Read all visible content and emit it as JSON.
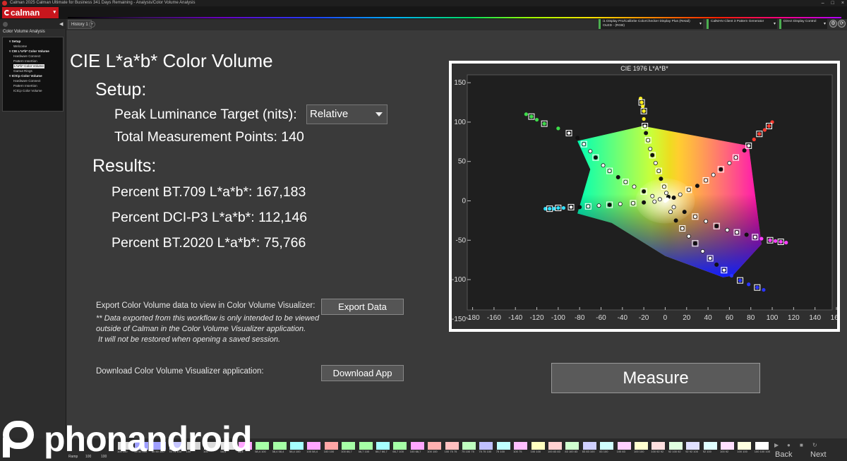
{
  "window": {
    "title": "Calman 2025 Calman Ultimate for Business 341 Days Remaining - Analysis/Color Volume Analysis",
    "controls": [
      "–",
      "□",
      "×"
    ]
  },
  "logo": {
    "text": "calman"
  },
  "sidebar": {
    "title": "Color Volume Analysis",
    "tree": [
      {
        "label": "Setup",
        "level": 1
      },
      {
        "label": "Welcome",
        "level": 2
      },
      {
        "label": "CIE L*a*b* Color Volume",
        "level": 1
      },
      {
        "label": "Hardware Connect",
        "level": 2
      },
      {
        "label": "Pattern Insertion",
        "level": 2
      },
      {
        "label": "L*a*b* Color Volume",
        "level": 2,
        "selected": true
      },
      {
        "label": "Gamut Rings",
        "level": 2
      },
      {
        "label": "ICtCp Color Volume",
        "level": 1
      },
      {
        "label": "Hardware Connect",
        "level": 2
      },
      {
        "label": "Pattern Insertion",
        "level": 2
      },
      {
        "label": "ICtCp Color Volume",
        "level": 2
      }
    ]
  },
  "tabs": {
    "history": "History 1",
    "add": "+"
  },
  "devices": [
    {
      "line1": "i1 Display Pro/Calibrite ColorChecker Display Plus (Retail)",
      "line2": "OLED - (RGB)"
    },
    {
      "line1": "CalMAN Client 3 Pattern Generator",
      "line2": ""
    },
    {
      "line1": "Direct Display Control",
      "line2": ""
    }
  ],
  "main": {
    "title": "CIE L*a*b* Color Volume",
    "setup_heading": "Setup:",
    "peak_label": "Peak Luminance Target (nits):",
    "peak_value": "Relative",
    "total_points": "Total Measurement Points: 140",
    "results_heading": "Results:",
    "result_709": "Percent BT.709 L*a*b*: 167,183",
    "result_p3": "Percent DCI-P3 L*a*b*: 112,146",
    "result_2020": "Percent BT.2020 L*a*b*: 75,766",
    "export_text": "Export Color Volume data to view in Color Volume Visualizer:",
    "export_button": "Export Data",
    "export_note": "** Data exported from this workflow is only intended to be viewed\noutside of Calman in the Color Volume Visualizer application.\n It will not be restored when opening a saved session.",
    "download_text": "Download Color Volume Visualizer application:",
    "download_button": "Download App",
    "measure_button": "Measure"
  },
  "chart_data": {
    "type": "scatter",
    "title": "CIE 1976 L*A*B*",
    "xlabel": "",
    "ylabel": "",
    "xlim": [
      -185,
      160
    ],
    "ylim": [
      -160,
      160
    ],
    "x_ticks": [
      -180,
      -160,
      -140,
      -120,
      -100,
      -80,
      -60,
      -40,
      -20,
      0,
      20,
      40,
      60,
      80,
      100,
      120,
      140,
      160
    ],
    "y_ticks": [
      150,
      100,
      50,
      0,
      -50,
      -100,
      -150
    ],
    "grid": false,
    "gamut_polygon": [
      [
        -82,
        76
      ],
      [
        -21,
        95
      ],
      [
        78,
        70
      ],
      [
        90,
        -55
      ],
      [
        63,
        -95
      ],
      [
        54,
        -97
      ],
      [
        0,
        -70
      ],
      [
        -50,
        -28
      ],
      [
        -82,
        -16
      ],
      [
        -70,
        40
      ]
    ],
    "series": [
      {
        "color": "#3ddc4a",
        "points": [
          [
            -130,
            110
          ],
          [
            -125,
            107
          ],
          [
            -120,
            103
          ],
          [
            -113,
            98
          ],
          [
            -100,
            92
          ],
          [
            -90,
            86
          ],
          [
            -82,
            80
          ],
          [
            -76,
            72
          ],
          [
            -70,
            63
          ],
          [
            -65,
            55
          ],
          [
            -58,
            45
          ],
          [
            -52,
            38
          ],
          [
            -44,
            30
          ],
          [
            -37,
            24
          ],
          [
            -29,
            18
          ],
          [
            -20,
            12
          ],
          [
            -12,
            6
          ],
          [
            -5,
            2
          ]
        ]
      },
      {
        "color": "#ffee20",
        "points": [
          [
            -23,
            130
          ],
          [
            -22,
            125
          ],
          [
            -21,
            120
          ],
          [
            -20,
            114
          ],
          [
            -20,
            104
          ],
          [
            -19,
            95
          ],
          [
            -18,
            86
          ],
          [
            -16,
            77
          ],
          [
            -14,
            66
          ],
          [
            -12,
            58
          ],
          [
            -9,
            48
          ],
          [
            -6,
            38
          ],
          [
            -4,
            28
          ],
          [
            -1,
            18
          ],
          [
            1,
            10
          ],
          [
            3,
            5
          ]
        ]
      },
      {
        "color": "#ff3b30",
        "points": [
          [
            100,
            100
          ],
          [
            97,
            95
          ],
          [
            93,
            90
          ],
          [
            88,
            85
          ],
          [
            83,
            78
          ],
          [
            78,
            70
          ],
          [
            74,
            64
          ],
          [
            66,
            55
          ],
          [
            60,
            48
          ],
          [
            52,
            40
          ],
          [
            45,
            33
          ],
          [
            38,
            26
          ],
          [
            30,
            19
          ],
          [
            22,
            14
          ],
          [
            14,
            8
          ],
          [
            8,
            4
          ]
        ]
      },
      {
        "color": "#30e0ff",
        "points": [
          [
            -112,
            -10
          ],
          [
            -108,
            -10
          ],
          [
            -104,
            -10
          ],
          [
            -100,
            -9
          ],
          [
            -95,
            -9
          ],
          [
            -88,
            -8
          ],
          [
            -80,
            -8
          ],
          [
            -72,
            -7
          ],
          [
            -62,
            -6
          ],
          [
            -52,
            -5
          ],
          [
            -42,
            -4
          ],
          [
            -30,
            -3
          ],
          [
            -20,
            -2
          ],
          [
            -10,
            -1
          ]
        ]
      },
      {
        "color": "#ff40ff",
        "points": [
          [
            113,
            -53
          ],
          [
            108,
            -52
          ],
          [
            103,
            -51
          ],
          [
            98,
            -50
          ],
          [
            90,
            -48
          ],
          [
            84,
            -46
          ],
          [
            76,
            -43
          ],
          [
            67,
            -40
          ],
          [
            58,
            -37
          ],
          [
            48,
            -32
          ],
          [
            38,
            -26
          ],
          [
            28,
            -20
          ],
          [
            18,
            -14
          ],
          [
            8,
            -8
          ]
        ]
      },
      {
        "color": "#2a34ff",
        "points": [
          [
            92,
            -113
          ],
          [
            86,
            -110
          ],
          [
            78,
            -106
          ],
          [
            70,
            -101
          ],
          [
            62,
            -95
          ],
          [
            55,
            -88
          ],
          [
            48,
            -81
          ],
          [
            42,
            -73
          ],
          [
            35,
            -64
          ],
          [
            28,
            -54
          ],
          [
            22,
            -45
          ],
          [
            16,
            -35
          ],
          [
            10,
            -25
          ],
          [
            5,
            -14
          ]
        ]
      },
      {
        "color": "#ffffff",
        "points": [
          [
            0,
            0
          ],
          [
            1,
            1
          ],
          [
            2,
            2
          ]
        ]
      }
    ]
  },
  "bottom": {
    "ramp_label": "Ramp",
    "ramp_values": [
      "100",
      "100"
    ],
    "back": "Back",
    "next": "Next",
    "patches": [
      {
        "color": "#d9d9d9",
        "label": "100 100"
      },
      {
        "color": "#9fa0ff",
        "label": "50 50 100"
      },
      {
        "color": "#a0a0ff",
        "label": "50 50 100"
      },
      {
        "color": "#c6c6ff",
        "label": "75 75 100"
      },
      {
        "color": "#d6d6d6",
        "label": "100"
      },
      {
        "color": "#dcdcdc",
        "label": "100"
      },
      {
        "color": "#e0e0e0",
        "label": "58,4"
      },
      {
        "color": "#ffa6ff",
        "label": "58,4"
      },
      {
        "color": "#a6ffa6",
        "label": "58,4 100"
      },
      {
        "color": "#a6ffa6",
        "label": "58,4 58,4"
      },
      {
        "color": "#a6ffff",
        "label": "58,4 100"
      },
      {
        "color": "#ffa6ff",
        "label": "100 58,4"
      },
      {
        "color": "#ffa6a6",
        "label": "100 100"
      },
      {
        "color": "#a6ffa6",
        "label": "100 66,7"
      },
      {
        "color": "#a6ffa6",
        "label": "66,7 100"
      },
      {
        "color": "#a6ffff",
        "label": "66,7 66,7"
      },
      {
        "color": "#a6ffa6",
        "label": "66,7 100"
      },
      {
        "color": "#ffa6ff",
        "label": "100 66,7"
      },
      {
        "color": "#ffb0b0",
        "label": "100 100"
      },
      {
        "color": "#ffc0c0",
        "label": "100 75 75"
      },
      {
        "color": "#c0ffc0",
        "label": "75 100 75"
      },
      {
        "color": "#c0c0ff",
        "label": "75 75 100"
      },
      {
        "color": "#c0ffff",
        "label": "75 100"
      },
      {
        "color": "#ffc0ff",
        "label": "100 75"
      },
      {
        "color": "#ffffc0",
        "label": "100 100"
      },
      {
        "color": "#ffd0d0",
        "label": "100 83 83"
      },
      {
        "color": "#d0ffd0",
        "label": "83 100 83"
      },
      {
        "color": "#d0d0ff",
        "label": "83 83 100"
      },
      {
        "color": "#d0ffff",
        "label": "83 100"
      },
      {
        "color": "#ffd0ff",
        "label": "100 83"
      },
      {
        "color": "#ffffd0",
        "label": "100 100"
      },
      {
        "color": "#ffe0e0",
        "label": "100 92 92"
      },
      {
        "color": "#e0ffe0",
        "label": "92 100 92"
      },
      {
        "color": "#e0e0ff",
        "label": "92 92 100"
      },
      {
        "color": "#e0ffff",
        "label": "92 100"
      },
      {
        "color": "#ffe0ff",
        "label": "100 92"
      },
      {
        "color": "#ffffe0",
        "label": "100 100"
      },
      {
        "color": "#ffffff",
        "label": "100 100 100"
      }
    ]
  },
  "watermark": {
    "text": "phonandroid"
  }
}
